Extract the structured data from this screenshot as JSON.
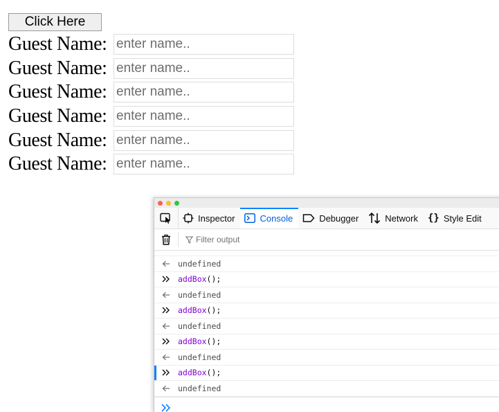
{
  "page": {
    "button_label": "Click Here",
    "guests": [
      {
        "label": "Guest Name:",
        "placeholder": "enter name.."
      },
      {
        "label": "Guest Name:",
        "placeholder": "enter name.."
      },
      {
        "label": "Guest Name:",
        "placeholder": "enter name.."
      },
      {
        "label": "Guest Name:",
        "placeholder": "enter name.."
      },
      {
        "label": "Guest Name:",
        "placeholder": "enter name.."
      },
      {
        "label": "Guest Name:",
        "placeholder": "enter name.."
      }
    ]
  },
  "devtools": {
    "tabs": [
      {
        "label": "Inspector",
        "icon": "inspector-icon"
      },
      {
        "label": "Console",
        "icon": "console-icon"
      },
      {
        "label": "Debugger",
        "icon": "debugger-icon"
      },
      {
        "label": "Network",
        "icon": "network-icon"
      },
      {
        "label": "Style Edit",
        "icon": "style-editor-icon"
      }
    ],
    "filter_placeholder": "Filter output",
    "log": [
      {
        "type": "result",
        "text": "undefined"
      },
      {
        "type": "input",
        "fn": "addBox",
        "rest": "();"
      },
      {
        "type": "result",
        "text": "undefined"
      },
      {
        "type": "input",
        "fn": "addBox",
        "rest": "();"
      },
      {
        "type": "result",
        "text": "undefined"
      },
      {
        "type": "input",
        "fn": "addBox",
        "rest": "();"
      },
      {
        "type": "result",
        "text": "undefined"
      },
      {
        "type": "input",
        "fn": "addBox",
        "rest": "();"
      },
      {
        "type": "result",
        "text": "undefined"
      }
    ],
    "colors": {
      "accent": "#0a84ff",
      "selected_tab_text": "#0060df",
      "function_name": "#8000d7"
    }
  }
}
